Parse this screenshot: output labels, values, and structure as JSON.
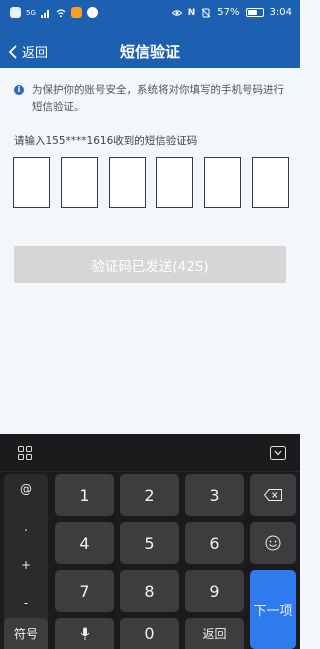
{
  "status_bar": {
    "signal_left": "5G",
    "battery_percent": "57%",
    "time": "3:04"
  },
  "nav": {
    "back_label": "返回",
    "title": "短信验证"
  },
  "notice": {
    "text": "为保护你的账号安全，系统将对你填写的手机号码进行短信验证。"
  },
  "prompt": "请输入155****1616收到的短信验证码",
  "code_boxes": [
    "",
    "",
    "",
    "",
    "",
    ""
  ],
  "send_button": {
    "label": "验证码已发送(42S)"
  },
  "keyboard": {
    "symbols": [
      "@",
      ".",
      "+",
      "-"
    ],
    "row1": [
      "1",
      "2",
      "3"
    ],
    "row2": [
      "4",
      "5",
      "6"
    ],
    "row3": [
      "7",
      "8",
      "9"
    ],
    "row4": [
      "符号",
      "0",
      "返回"
    ],
    "next_label": "下一项",
    "icons": {
      "grid": "grid-icon",
      "hide": "keyboard-hide-icon",
      "backspace": "backspace-icon",
      "emoji": "emoji-icon",
      "mic": "microphone-icon"
    }
  },
  "colors": {
    "header_bg": "#1d5fb1",
    "button_disabled": "#d6d6d6",
    "next_key": "#2e7bef",
    "keyboard_bg": "#1b1b1d"
  }
}
